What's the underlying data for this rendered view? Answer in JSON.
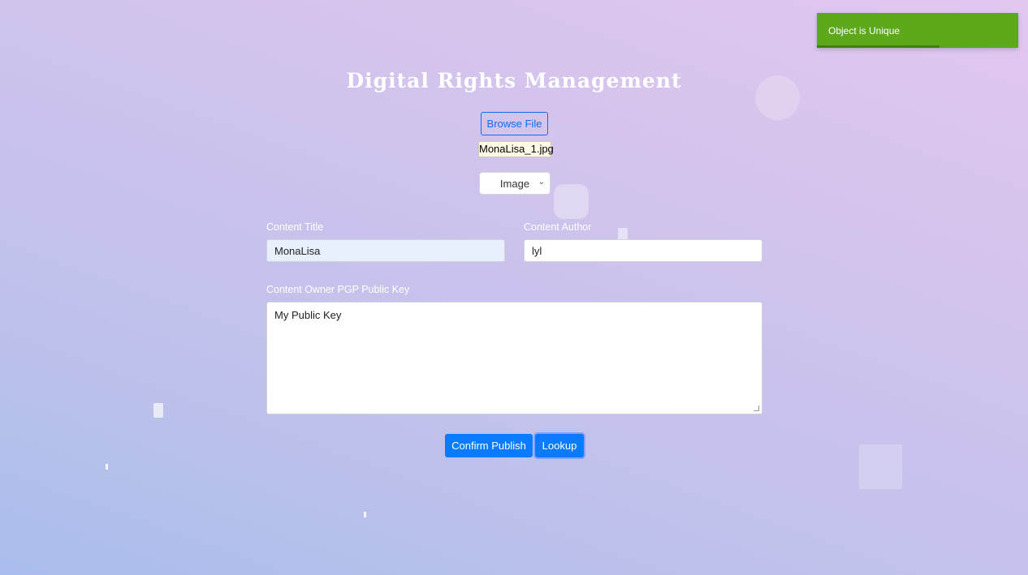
{
  "toast": {
    "message": "Object is Unique",
    "progress_percent": 61,
    "color": "#5ea91a"
  },
  "header": {
    "title": "Digital Rights Management"
  },
  "upload": {
    "browse_label": "Browse File",
    "filename": "MonaLisa_1.jpg"
  },
  "content_type": {
    "selected": "Image"
  },
  "form": {
    "title_label": "Content Title",
    "title_value": "MonaLisa",
    "author_label": "Content Author",
    "author_value": "lyl",
    "key_label": "Content Owner PGP Public Key",
    "key_value": "My Public Key"
  },
  "actions": {
    "publish_label": "Confirm Publish",
    "lookup_label": "Lookup"
  },
  "colors": {
    "accent": "#0a7bff"
  }
}
